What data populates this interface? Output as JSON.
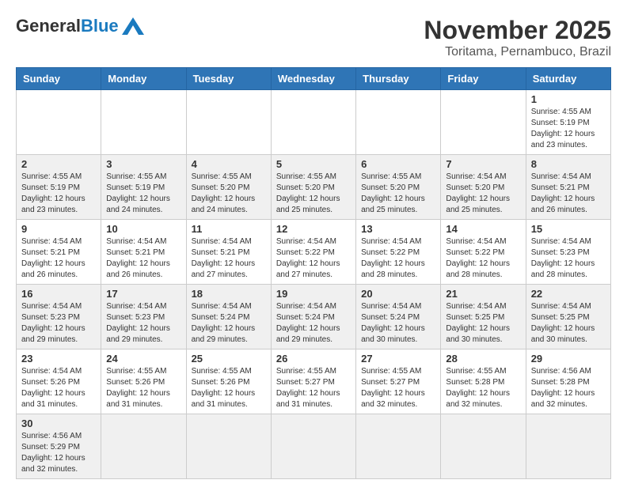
{
  "header": {
    "logo_general": "General",
    "logo_blue": "Blue",
    "month_title": "November 2025",
    "location": "Toritama, Pernambuco, Brazil"
  },
  "weekdays": [
    "Sunday",
    "Monday",
    "Tuesday",
    "Wednesday",
    "Thursday",
    "Friday",
    "Saturday"
  ],
  "weeks": [
    [
      {
        "day": "",
        "info": ""
      },
      {
        "day": "",
        "info": ""
      },
      {
        "day": "",
        "info": ""
      },
      {
        "day": "",
        "info": ""
      },
      {
        "day": "",
        "info": ""
      },
      {
        "day": "",
        "info": ""
      },
      {
        "day": "1",
        "info": "Sunrise: 4:55 AM\nSunset: 5:19 PM\nDaylight: 12 hours and 23 minutes."
      }
    ],
    [
      {
        "day": "2",
        "info": "Sunrise: 4:55 AM\nSunset: 5:19 PM\nDaylight: 12 hours and 23 minutes."
      },
      {
        "day": "3",
        "info": "Sunrise: 4:55 AM\nSunset: 5:19 PM\nDaylight: 12 hours and 24 minutes."
      },
      {
        "day": "4",
        "info": "Sunrise: 4:55 AM\nSunset: 5:20 PM\nDaylight: 12 hours and 24 minutes."
      },
      {
        "day": "5",
        "info": "Sunrise: 4:55 AM\nSunset: 5:20 PM\nDaylight: 12 hours and 25 minutes."
      },
      {
        "day": "6",
        "info": "Sunrise: 4:55 AM\nSunset: 5:20 PM\nDaylight: 12 hours and 25 minutes."
      },
      {
        "day": "7",
        "info": "Sunrise: 4:54 AM\nSunset: 5:20 PM\nDaylight: 12 hours and 25 minutes."
      },
      {
        "day": "8",
        "info": "Sunrise: 4:54 AM\nSunset: 5:21 PM\nDaylight: 12 hours and 26 minutes."
      }
    ],
    [
      {
        "day": "9",
        "info": "Sunrise: 4:54 AM\nSunset: 5:21 PM\nDaylight: 12 hours and 26 minutes."
      },
      {
        "day": "10",
        "info": "Sunrise: 4:54 AM\nSunset: 5:21 PM\nDaylight: 12 hours and 26 minutes."
      },
      {
        "day": "11",
        "info": "Sunrise: 4:54 AM\nSunset: 5:21 PM\nDaylight: 12 hours and 27 minutes."
      },
      {
        "day": "12",
        "info": "Sunrise: 4:54 AM\nSunset: 5:22 PM\nDaylight: 12 hours and 27 minutes."
      },
      {
        "day": "13",
        "info": "Sunrise: 4:54 AM\nSunset: 5:22 PM\nDaylight: 12 hours and 28 minutes."
      },
      {
        "day": "14",
        "info": "Sunrise: 4:54 AM\nSunset: 5:22 PM\nDaylight: 12 hours and 28 minutes."
      },
      {
        "day": "15",
        "info": "Sunrise: 4:54 AM\nSunset: 5:23 PM\nDaylight: 12 hours and 28 minutes."
      }
    ],
    [
      {
        "day": "16",
        "info": "Sunrise: 4:54 AM\nSunset: 5:23 PM\nDaylight: 12 hours and 29 minutes."
      },
      {
        "day": "17",
        "info": "Sunrise: 4:54 AM\nSunset: 5:23 PM\nDaylight: 12 hours and 29 minutes."
      },
      {
        "day": "18",
        "info": "Sunrise: 4:54 AM\nSunset: 5:24 PM\nDaylight: 12 hours and 29 minutes."
      },
      {
        "day": "19",
        "info": "Sunrise: 4:54 AM\nSunset: 5:24 PM\nDaylight: 12 hours and 29 minutes."
      },
      {
        "day": "20",
        "info": "Sunrise: 4:54 AM\nSunset: 5:24 PM\nDaylight: 12 hours and 30 minutes."
      },
      {
        "day": "21",
        "info": "Sunrise: 4:54 AM\nSunset: 5:25 PM\nDaylight: 12 hours and 30 minutes."
      },
      {
        "day": "22",
        "info": "Sunrise: 4:54 AM\nSunset: 5:25 PM\nDaylight: 12 hours and 30 minutes."
      }
    ],
    [
      {
        "day": "23",
        "info": "Sunrise: 4:54 AM\nSunset: 5:26 PM\nDaylight: 12 hours and 31 minutes."
      },
      {
        "day": "24",
        "info": "Sunrise: 4:55 AM\nSunset: 5:26 PM\nDaylight: 12 hours and 31 minutes."
      },
      {
        "day": "25",
        "info": "Sunrise: 4:55 AM\nSunset: 5:26 PM\nDaylight: 12 hours and 31 minutes."
      },
      {
        "day": "26",
        "info": "Sunrise: 4:55 AM\nSunset: 5:27 PM\nDaylight: 12 hours and 31 minutes."
      },
      {
        "day": "27",
        "info": "Sunrise: 4:55 AM\nSunset: 5:27 PM\nDaylight: 12 hours and 32 minutes."
      },
      {
        "day": "28",
        "info": "Sunrise: 4:55 AM\nSunset: 5:28 PM\nDaylight: 12 hours and 32 minutes."
      },
      {
        "day": "29",
        "info": "Sunrise: 4:56 AM\nSunset: 5:28 PM\nDaylight: 12 hours and 32 minutes."
      }
    ],
    [
      {
        "day": "30",
        "info": "Sunrise: 4:56 AM\nSunset: 5:29 PM\nDaylight: 12 hours and 32 minutes."
      },
      {
        "day": "",
        "info": ""
      },
      {
        "day": "",
        "info": ""
      },
      {
        "day": "",
        "info": ""
      },
      {
        "day": "",
        "info": ""
      },
      {
        "day": "",
        "info": ""
      },
      {
        "day": "",
        "info": ""
      }
    ]
  ]
}
